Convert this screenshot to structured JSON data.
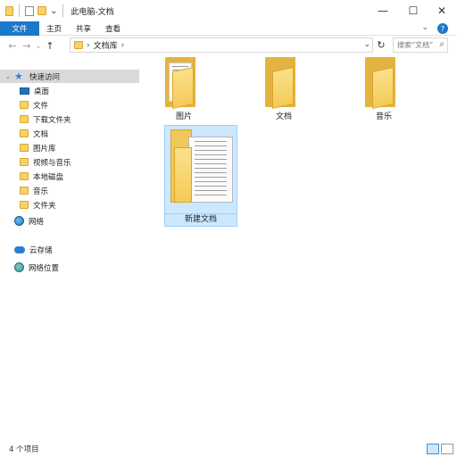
{
  "window": {
    "title": "此电脑-文档",
    "minimize_glyph": "—",
    "maximize_glyph": "☐",
    "close_glyph": "✕"
  },
  "ribbon": {
    "tabs": [
      "文件",
      "主页",
      "共享",
      "查看"
    ],
    "expand_glyph": "⌄",
    "help_glyph": "?"
  },
  "navigation": {
    "back_glyph": "←",
    "forward_glyph": "→",
    "recent_glyph": "⌄",
    "up_glyph": "↑",
    "breadcrumb": [
      "文档库"
    ],
    "refresh_glyph": "↻",
    "search_placeholder": "搜索“文档”"
  },
  "sidebar": {
    "items": [
      {
        "label": "快速访问",
        "icon": "star-icon",
        "selected": true
      },
      {
        "label": "桌面",
        "icon": "desktop-icon",
        "selected": false
      },
      {
        "label": "文件",
        "icon": "folder-icon",
        "selected": false
      },
      {
        "label": "下载文件夹",
        "icon": "folder-icon",
        "selected": false
      },
      {
        "label": "文档",
        "icon": "folder-icon",
        "selected": false
      },
      {
        "label": "图片库",
        "icon": "folder-icon",
        "selected": false
      },
      {
        "label": "视频与音乐",
        "icon": "folder-icon",
        "selected": false
      },
      {
        "label": "本地磁盘",
        "icon": "folder-icon",
        "selected": false
      },
      {
        "label": "音乐",
        "icon": "folder-icon",
        "selected": false
      },
      {
        "label": "文件夹",
        "icon": "folder-icon",
        "selected": false
      },
      {
        "label": "网络",
        "icon": "globe-icon",
        "selected": false
      },
      {
        "label": "云存储",
        "icon": "cloud-icon",
        "selected": false
      },
      {
        "label": "网络位置",
        "icon": "network-icon",
        "selected": false
      }
    ]
  },
  "content": {
    "items": [
      {
        "label": "图片",
        "type": "folder-with-file",
        "selected": false
      },
      {
        "label": "文档",
        "type": "folder",
        "selected": false
      },
      {
        "label": "音乐",
        "type": "folder",
        "selected": false
      },
      {
        "label": "新建文档",
        "type": "folder-with-document",
        "selected": true
      }
    ]
  },
  "status": {
    "count_text": "4 个项目"
  }
}
